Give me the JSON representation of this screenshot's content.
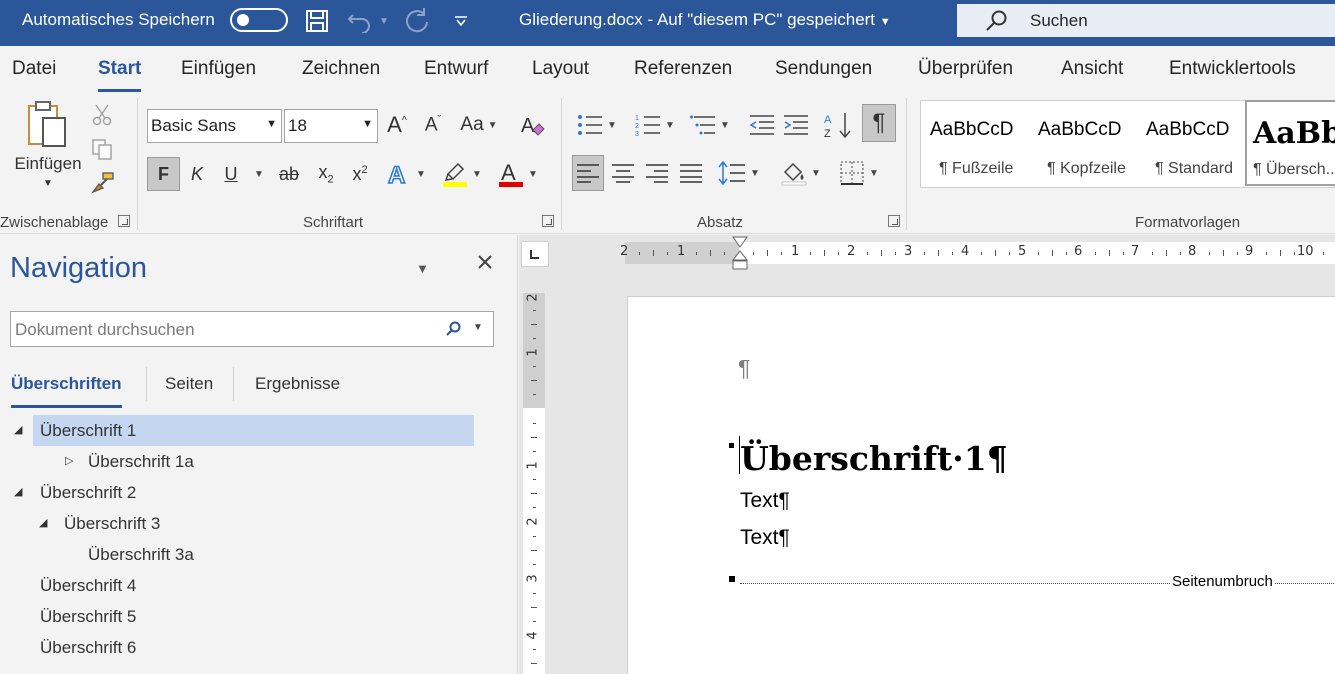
{
  "titlebar": {
    "autosave_label": "Automatisches Speichern",
    "autosave_state": "off",
    "doc_title": "Gliederung.docx  -  Auf \"diesem PC\" gespeichert",
    "search_label": "Suchen"
  },
  "tabs": [
    "Datei",
    "Start",
    "Einfügen",
    "Zeichnen",
    "Entwurf",
    "Layout",
    "Referenzen",
    "Sendungen",
    "Überprüfen",
    "Ansicht",
    "Entwicklertools"
  ],
  "active_tab": "Start",
  "ribbon": {
    "clipboard": {
      "paste_label": "Einfügen",
      "group_label": "Zwischenablage"
    },
    "font": {
      "font_name": "Basic Sans",
      "font_size": "18",
      "bold_label": "F",
      "italic_label": "K",
      "underline_label": "U",
      "strike_label": "ab",
      "case_label": "Aa",
      "group_label": "Schriftart"
    },
    "paragraph": {
      "group_label": "Absatz"
    },
    "styles": {
      "group_label": "Formatvorlagen",
      "items": [
        {
          "preview": "AaBbCcD",
          "name": "¶ Fußzeile"
        },
        {
          "preview": "AaBbCcD",
          "name": "¶ Kopfzeile"
        },
        {
          "preview": "AaBbCcD",
          "name": "¶ Standard"
        },
        {
          "preview": "AaBb",
          "name": "¶ Übersch..."
        }
      ]
    }
  },
  "nav": {
    "title": "Navigation",
    "search_placeholder": "Dokument durchsuchen",
    "tabs": [
      "Überschriften",
      "Seiten",
      "Ergebnisse"
    ],
    "tree": [
      {
        "label": "Überschrift 1",
        "twisty": "expanded",
        "selected": true
      },
      {
        "label": "Überschrift 1a",
        "twisty": "collapsed"
      },
      {
        "label": "Überschrift 2",
        "twisty": "expanded"
      },
      {
        "label": "Überschrift 3",
        "twisty": "expanded"
      },
      {
        "label": "Überschrift 3a",
        "twisty": "none"
      },
      {
        "label": "Überschrift 4",
        "twisty": "none"
      },
      {
        "label": "Überschrift 5",
        "twisty": "none"
      },
      {
        "label": "Überschrift 6",
        "twisty": "none"
      }
    ]
  },
  "ruler": {
    "h_labels": [
      "2",
      "1",
      "1",
      "2",
      "3",
      "4",
      "5",
      "6",
      "7",
      "8",
      "9",
      "10"
    ],
    "v_labels": [
      "2",
      "1",
      "1",
      "2",
      "3",
      "4"
    ]
  },
  "document": {
    "empty_paragraph": "¶",
    "heading": "Überschrift·1¶",
    "lines": [
      "Text¶",
      "Text¶"
    ],
    "page_break_label": "Seitenumbruch"
  },
  "colors": {
    "accent": "#2b579a",
    "nav_selected": "#c5d6f1",
    "font_red": "#e00000",
    "highlight_yellow": "#ffff00"
  }
}
